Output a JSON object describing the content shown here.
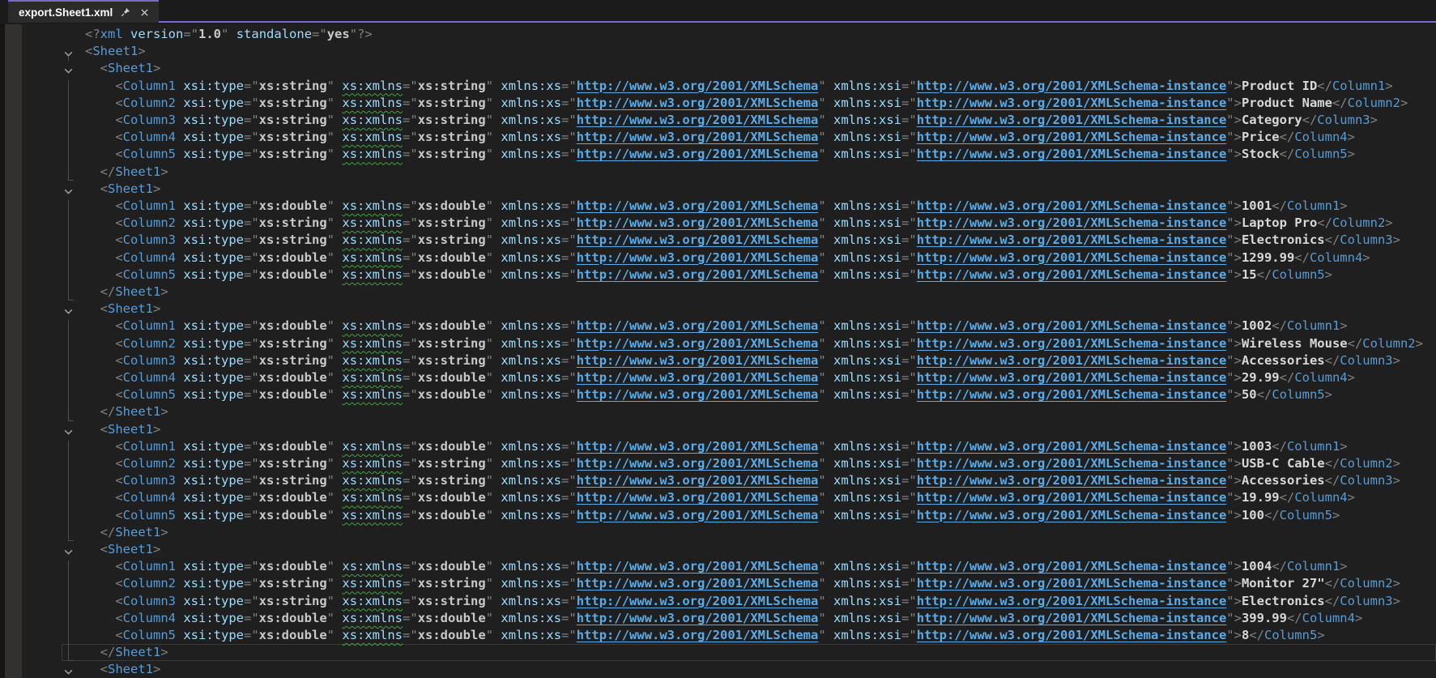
{
  "tab": {
    "title": "export.Sheet1.xml"
  },
  "ui": {
    "accent_purple": "#7a6ad0",
    "editor_background": "#1f1f1f",
    "tag_color": "#569cd6",
    "attribute_color": "#9cdcfe",
    "value_color": "#c8c8c8",
    "punctuation_color": "#808080",
    "link_color": "#5aabe8",
    "squiggle_color": "#3fa33f"
  },
  "xml": {
    "declaration": {
      "version": "1.0",
      "standalone": "yes"
    },
    "root_tag": "Sheet1",
    "record_tag": "Sheet1",
    "column_tag_prefix": "Column",
    "attributes": {
      "type_attr": "xsi:type",
      "xmlns_attr": "xs:xmlns",
      "xs_ns_attr": "xmlns:xs",
      "xsi_ns_attr": "xmlns:xsi",
      "xs_ns_url": "http://www.w3.org/2001/XMLSchema",
      "xsi_ns_url": "http://www.w3.org/2001/XMLSchema-instance"
    },
    "header": {
      "types": [
        "xs:string",
        "xs:string",
        "xs:string",
        "xs:string",
        "xs:string"
      ],
      "values": [
        "Product ID",
        "Product Name",
        "Category",
        "Price",
        "Stock"
      ]
    },
    "rows": [
      {
        "types": [
          "xs:double",
          "xs:string",
          "xs:string",
          "xs:double",
          "xs:double"
        ],
        "values": [
          "1001",
          "Laptop Pro",
          "Electronics",
          "1299.99",
          "15"
        ]
      },
      {
        "types": [
          "xs:double",
          "xs:string",
          "xs:string",
          "xs:double",
          "xs:double"
        ],
        "values": [
          "1002",
          "Wireless Mouse",
          "Accessories",
          "29.99",
          "50"
        ]
      },
      {
        "types": [
          "xs:double",
          "xs:string",
          "xs:string",
          "xs:double",
          "xs:double"
        ],
        "values": [
          "1003",
          "USB-C Cable",
          "Accessories",
          "19.99",
          "100"
        ]
      },
      {
        "types": [
          "xs:double",
          "xs:string",
          "xs:string",
          "xs:double",
          "xs:double"
        ],
        "values": [
          "1004",
          "Monitor 27\"",
          "Electronics",
          "399.99",
          "8"
        ]
      }
    ],
    "trailing_open_tag": true
  },
  "editor_state": {
    "current_line": 37,
    "warning_squiggle_on": "xs:xmlns"
  }
}
